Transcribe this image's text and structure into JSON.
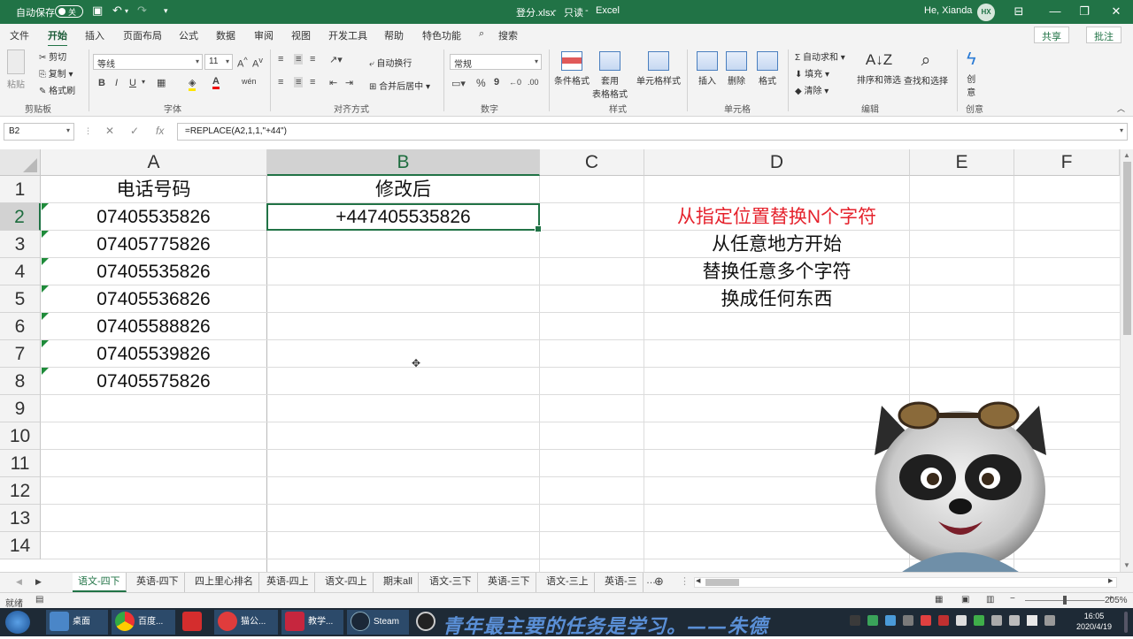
{
  "titlebar": {
    "autosave_label": "自动保存",
    "autosave_state": "关",
    "filename": "登分.xlsx",
    "readonly": "只读",
    "app": "Excel",
    "user": "He, Xianda",
    "user_initials": "HX"
  },
  "menu": {
    "tabs": [
      "文件",
      "开始",
      "插入",
      "页面布局",
      "公式",
      "数据",
      "审阅",
      "视图",
      "开发工具",
      "帮助",
      "特色功能"
    ],
    "active": "开始",
    "search": "搜索",
    "share": "共享",
    "comment": "批注"
  },
  "ribbon": {
    "clipboard": {
      "paste": "粘贴",
      "cut": "剪切",
      "copy": "复制",
      "format_painter": "格式刷",
      "label": "剪贴板"
    },
    "font": {
      "name": "等线",
      "size": "11",
      "label": "字体"
    },
    "alignment": {
      "wrap": "自动换行",
      "merge": "合并后居中",
      "label": "对齐方式"
    },
    "number": {
      "format": "常规",
      "label": "数字"
    },
    "styles": {
      "conditional": "条件格式",
      "table_line1": "套用",
      "table_line2": "表格格式",
      "cell_styles": "单元格样式",
      "label": "样式"
    },
    "cells": {
      "insert": "插入",
      "delete": "删除",
      "format": "格式",
      "label": "单元格"
    },
    "editing": {
      "autosum": "自动求和",
      "fill": "填充",
      "clear": "清除",
      "sort": "排序和筛选",
      "find": "查找和选择",
      "label": "编辑"
    },
    "creative": {
      "idea_line1": "创",
      "idea_line2": "意",
      "label": "创意"
    }
  },
  "formula_bar": {
    "name_box": "B2",
    "formula": "=REPLACE(A2,1,1,\"+44\")"
  },
  "sheet": {
    "columns": [
      "A",
      "B",
      "C",
      "D",
      "E",
      "F"
    ],
    "selected_column": "B",
    "selected_row": 2,
    "rows": [
      "1",
      "2",
      "3",
      "4",
      "5",
      "6",
      "7",
      "8",
      "9",
      "10",
      "11",
      "12",
      "13",
      "14"
    ],
    "A": [
      "电话号码",
      "07405535826",
      "07405775826",
      "07405535826",
      "07405536826",
      "07405588826",
      "07405539826",
      "07405575826"
    ],
    "B": [
      "修改后",
      "+447405535826"
    ],
    "D": [
      "从指定位置替换N个字符",
      "从任意地方开始",
      "替换任意多个字符",
      "换成任何东西"
    ],
    "D_first_color": "#e5222c"
  },
  "sheet_tabs": [
    "语文-四下",
    "英语-四下",
    "四上里心排名",
    "英语-四上",
    "语文-四上",
    "期末all",
    "语文-三下",
    "英语-三下",
    "语文-三上",
    "英语-三"
  ],
  "active_sheet_tab": "语文-四下",
  "status": {
    "ready": "就绪",
    "zoom": "205%"
  },
  "taskbar": {
    "items": [
      "桌面",
      "百度...",
      "猫公...",
      "教学...",
      "Steam"
    ],
    "caption": "青年最主要的任务是学习。——朱德",
    "time": "16:05",
    "date": "2020/4/19"
  },
  "colors": {
    "accent": "#217346",
    "taskbar": "#1e2a36"
  }
}
